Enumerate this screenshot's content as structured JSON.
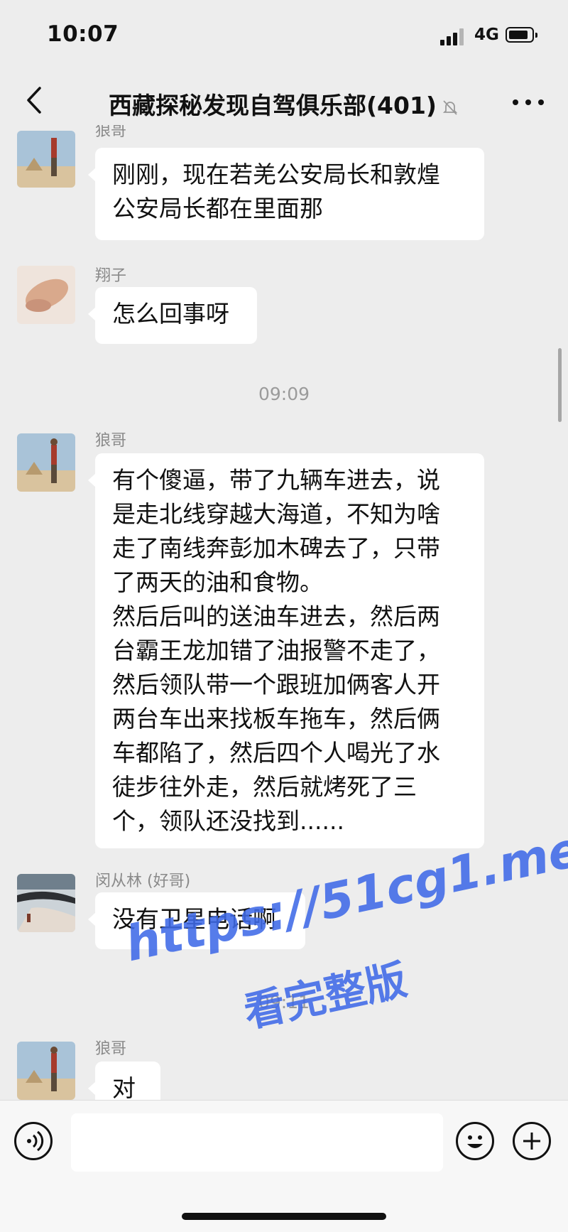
{
  "status_bar": {
    "time": "10:07",
    "network": "4G"
  },
  "header": {
    "title": "西藏探秘发现自驾俱乐部(401)",
    "icons": [
      "back-icon",
      "mute-bell-icon",
      "more-icon"
    ]
  },
  "messages": [
    {
      "sender": "狼哥",
      "text": "刚刚，现在若羌公安局长和敦煌\n公安局长都在里面那"
    },
    {
      "sender": "翔子",
      "text": "怎么回事呀"
    },
    {
      "time": "09:09"
    },
    {
      "sender": "狼哥",
      "text": "有个傻逼，带了九辆车进去，说\n是走北线穿越大海道，不知为啥\n走了南线奔彭加木碑去了，只带\n了两天的油和食物。\n然后后叫的送油车进去，然后两\n台霸王龙加错了油报警不走了，\n然后领队带一个跟班加俩客人开\n两台车出来找板车拖车，然后俩\n车都陷了，然后四个人喝光了水\n徒步往外走，然后就烤死了三\n个，领队还没找到......"
    },
    {
      "sender": "闵从林 (好哥)",
      "text": "没有卫星电话啊"
    },
    {
      "time": "09:11"
    },
    {
      "sender": "狼哥",
      "text": "对"
    }
  ],
  "input_bar": {
    "icons": [
      "voice-icon",
      "emoji-icon",
      "plus-icon"
    ]
  },
  "watermark": {
    "url": "https://51cg1.me",
    "caption": "看完整版"
  },
  "colors": {
    "background": "#ededed",
    "bubble": "#ffffff",
    "watermark": "#3f6ae8"
  }
}
